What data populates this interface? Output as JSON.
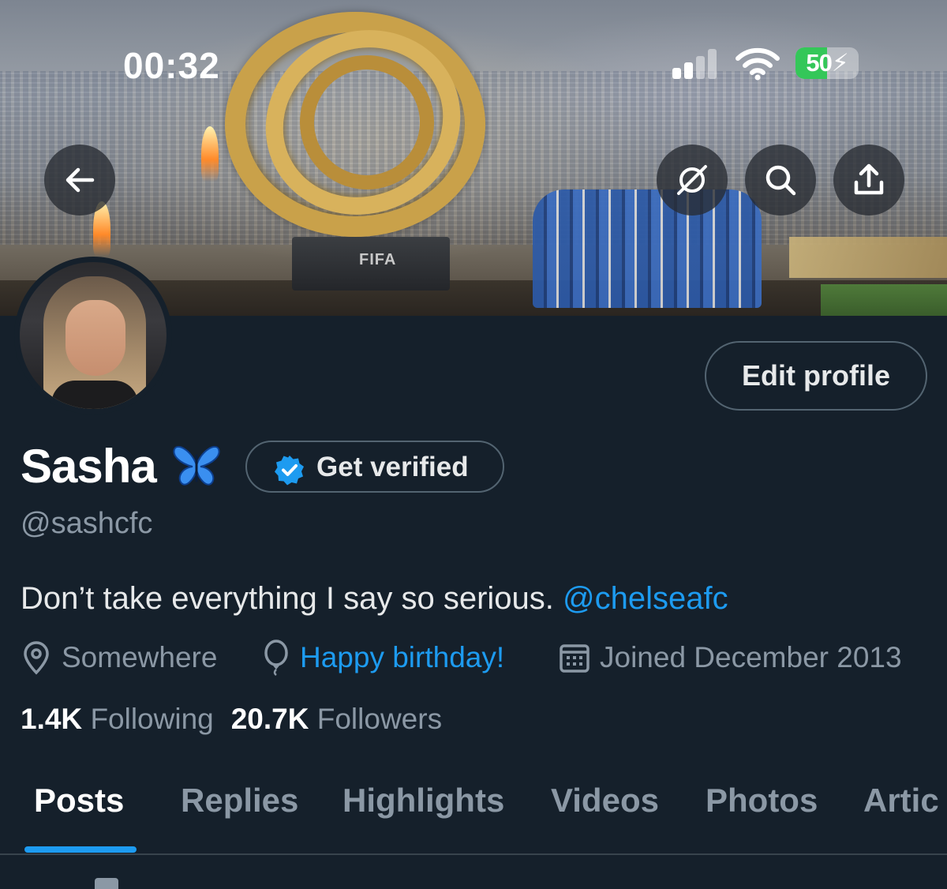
{
  "status_bar": {
    "time": "00:32",
    "battery_level": "50",
    "battery_percent_value": 50,
    "battery_color": "#34c759",
    "charging_icon": "bolt-icon"
  },
  "banner": {
    "board_text": "FIFA",
    "header_buttons": [
      {
        "name": "back",
        "icon": "arrow-left-icon"
      },
      {
        "name": "grok",
        "icon": "grok-icon"
      },
      {
        "name": "search",
        "icon": "search-icon"
      },
      {
        "name": "share",
        "icon": "share-icon"
      }
    ]
  },
  "profile": {
    "display_name": "Sasha",
    "name_emoji": "butterfly-icon",
    "handle": "@sashcfc",
    "edit_label": "Edit profile",
    "get_verified_label": "Get verified",
    "bio_text": "Don’t take everything I say so serious. ",
    "bio_mention": "@chelseafc",
    "location": "Somewhere",
    "birthday": "Happy birthday!",
    "joined": "Joined December 2013",
    "following_count": "1.4K",
    "following_label": "Following",
    "followers_count": "20.7K",
    "followers_label": "Followers"
  },
  "tabs": [
    {
      "label": "Posts",
      "active": true
    },
    {
      "label": "Replies",
      "active": false
    },
    {
      "label": "Highlights",
      "active": false
    },
    {
      "label": "Videos",
      "active": false
    },
    {
      "label": "Photos",
      "active": false
    },
    {
      "label": "Artic",
      "active": false
    }
  ],
  "colors": {
    "background": "#15202b",
    "accent": "#1d9bf0",
    "secondary_text": "#8b98a5",
    "border": "#536471"
  }
}
